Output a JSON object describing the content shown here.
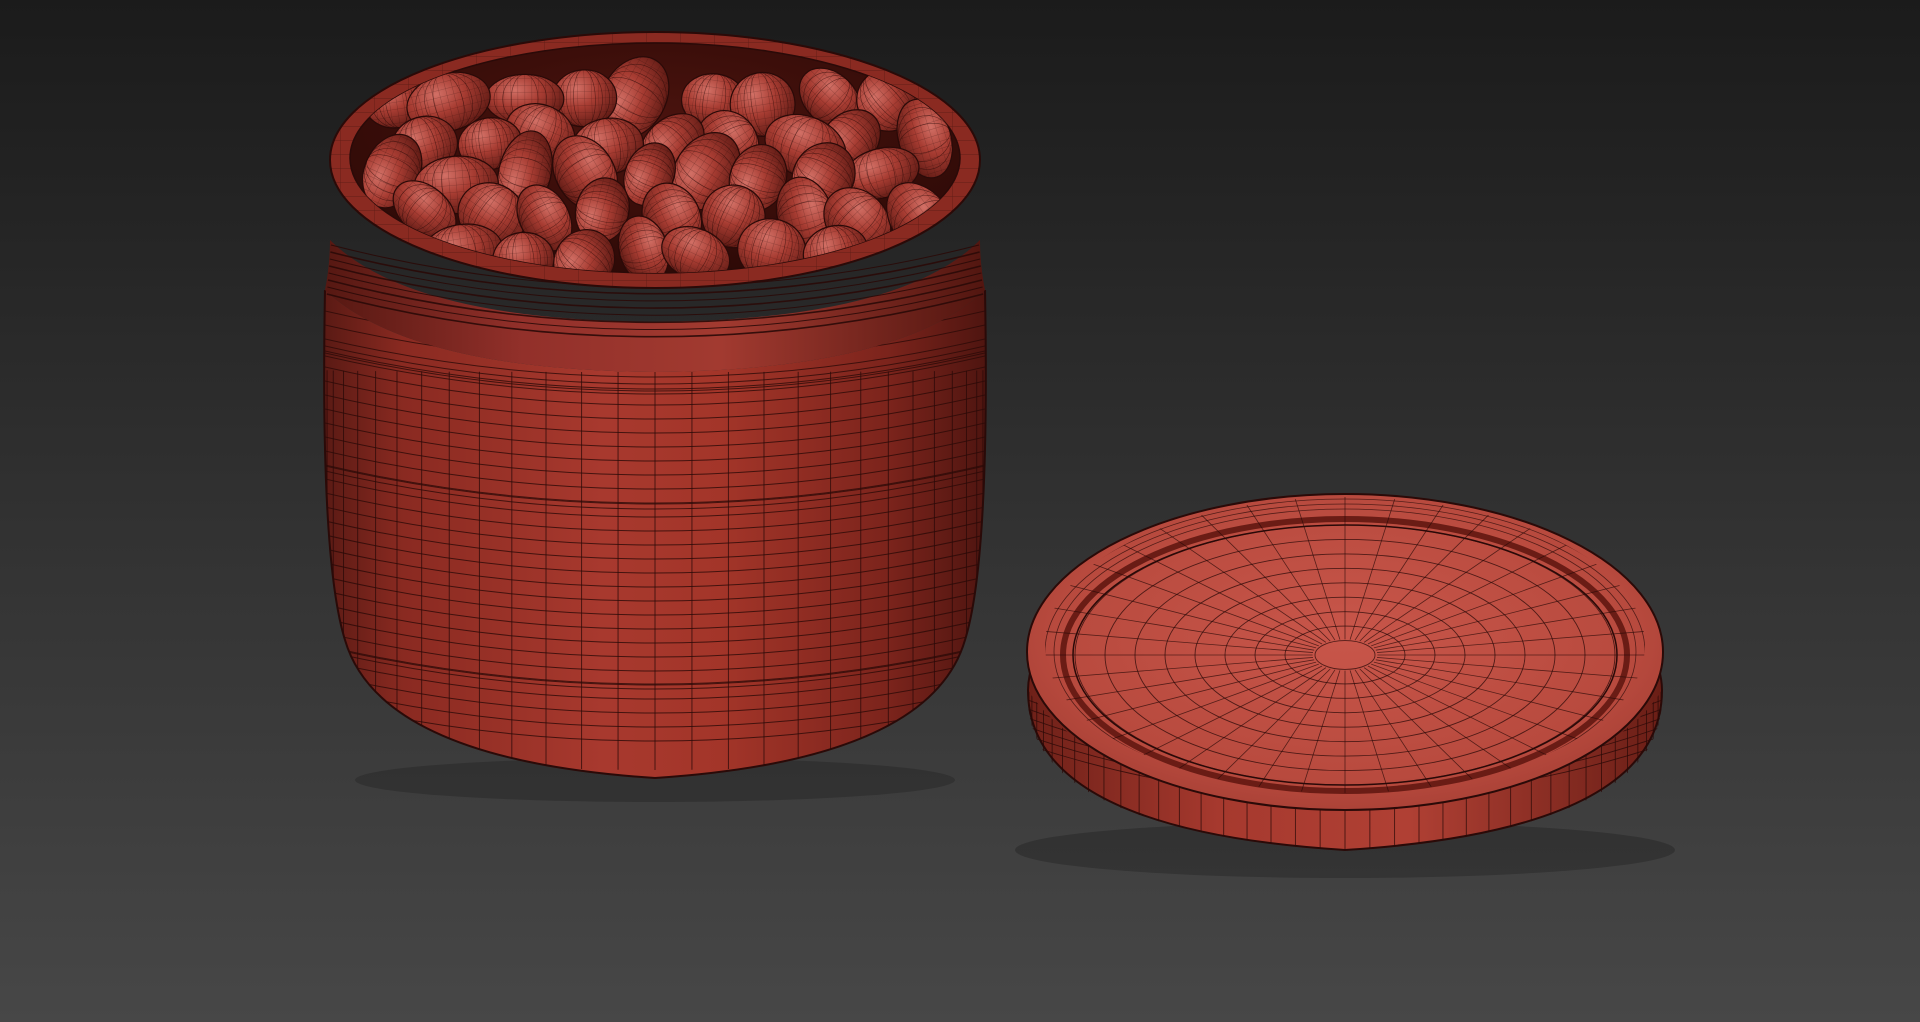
{
  "viewport": {
    "background_top": "#1b1b1b",
    "background_bottom": "#474747"
  },
  "objects": [
    {
      "name": "jar",
      "color": "#9c3128",
      "wire": "#2a0a08"
    },
    {
      "name": "lid",
      "color": "#b6483b",
      "wire": "#2a0a08"
    },
    {
      "name": "beans",
      "count": 46,
      "color": "#a83d33"
    }
  ]
}
